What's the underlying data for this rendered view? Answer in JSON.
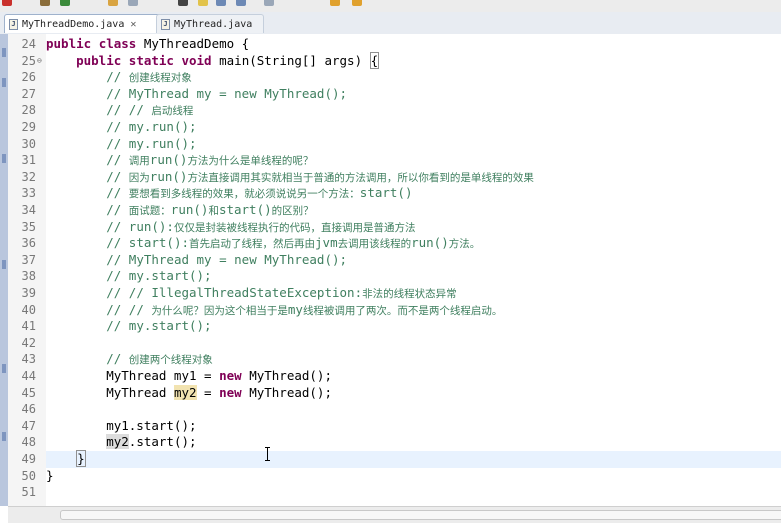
{
  "tabs": [
    {
      "label": "MyThreadDemo.java",
      "icon": "java-file-icon",
      "active": true
    },
    {
      "label": "MyThread.java",
      "icon": "java-file-icon",
      "active": false
    }
  ],
  "colors": {
    "keyword": "#7f0055",
    "comment": "#3f7f5f",
    "text": "#000000",
    "line_number": "#787878",
    "current_line": "#e8f2fe"
  },
  "lines": [
    {
      "n": "24",
      "fold": "",
      "segs": [
        [
          "public ",
          "kw"
        ],
        [
          "class ",
          "kw"
        ],
        [
          "MyThreadDemo {",
          ""
        ]
      ]
    },
    {
      "n": "25",
      "fold": "⊖",
      "segs": [
        [
          "    ",
          ""
        ],
        [
          "public ",
          "kw"
        ],
        [
          "static ",
          "kw"
        ],
        [
          "void ",
          "kw"
        ],
        [
          "main(String[] args) ",
          ""
        ],
        [
          "{",
          "brk"
        ]
      ]
    },
    {
      "n": "26",
      "fold": "",
      "segs": [
        [
          "        ",
          ""
        ],
        [
          "// ",
          "cm"
        ],
        [
          "创建线程对象",
          "cm cjk"
        ]
      ]
    },
    {
      "n": "27",
      "fold": "",
      "segs": [
        [
          "        ",
          ""
        ],
        [
          "// MyThread my = new MyThread();",
          "cm"
        ]
      ]
    },
    {
      "n": "28",
      "fold": "",
      "segs": [
        [
          "        ",
          ""
        ],
        [
          "// // ",
          "cm"
        ],
        [
          "启动线程",
          "cm cjk"
        ]
      ]
    },
    {
      "n": "29",
      "fold": "",
      "segs": [
        [
          "        ",
          ""
        ],
        [
          "// my.run();",
          "cm"
        ]
      ]
    },
    {
      "n": "30",
      "fold": "",
      "segs": [
        [
          "        ",
          ""
        ],
        [
          "// my.run();",
          "cm"
        ]
      ]
    },
    {
      "n": "31",
      "fold": "",
      "segs": [
        [
          "        ",
          ""
        ],
        [
          "// ",
          "cm"
        ],
        [
          "调用",
          "cm cjk"
        ],
        [
          "run()",
          "cm"
        ],
        [
          "方法为什么是单线程的呢？",
          "cm cjk"
        ]
      ]
    },
    {
      "n": "32",
      "fold": "",
      "segs": [
        [
          "        ",
          ""
        ],
        [
          "// ",
          "cm"
        ],
        [
          "因为",
          "cm cjk"
        ],
        [
          "run()",
          "cm"
        ],
        [
          "方法直接调用其实就相当于普通的方法调用，所以你看到的是单线程的效果",
          "cm cjk"
        ]
      ]
    },
    {
      "n": "33",
      "fold": "",
      "segs": [
        [
          "        ",
          ""
        ],
        [
          "// ",
          "cm"
        ],
        [
          "要想看到多线程的效果，就必须说说另一个方法：",
          "cm cjk"
        ],
        [
          "start()",
          "cm"
        ]
      ]
    },
    {
      "n": "34",
      "fold": "",
      "segs": [
        [
          "        ",
          ""
        ],
        [
          "// ",
          "cm"
        ],
        [
          "面试题：",
          "cm cjk"
        ],
        [
          "run()",
          "cm"
        ],
        [
          "和",
          "cm cjk"
        ],
        [
          "start()",
          "cm"
        ],
        [
          "的区别？",
          "cm cjk"
        ]
      ]
    },
    {
      "n": "35",
      "fold": "",
      "segs": [
        [
          "        ",
          ""
        ],
        [
          "// run():",
          "cm"
        ],
        [
          "仅仅是封装被线程执行的代码，直接调用是普通方法",
          "cm cjk"
        ]
      ]
    },
    {
      "n": "36",
      "fold": "",
      "segs": [
        [
          "        ",
          ""
        ],
        [
          "// start():",
          "cm"
        ],
        [
          "首先启动了线程，然后再由",
          "cm cjk"
        ],
        [
          "jvm",
          "cm"
        ],
        [
          "去调用该线程的",
          "cm cjk"
        ],
        [
          "run()",
          "cm"
        ],
        [
          "方法。",
          "cm cjk"
        ]
      ]
    },
    {
      "n": "37",
      "fold": "",
      "segs": [
        [
          "        ",
          ""
        ],
        [
          "// MyThread my = new MyThread();",
          "cm"
        ]
      ]
    },
    {
      "n": "38",
      "fold": "",
      "segs": [
        [
          "        ",
          ""
        ],
        [
          "// my.start();",
          "cm"
        ]
      ]
    },
    {
      "n": "39",
      "fold": "",
      "segs": [
        [
          "        ",
          ""
        ],
        [
          "// // IllegalThreadStateException:",
          "cm"
        ],
        [
          "非法的线程状态异常",
          "cm cjk"
        ]
      ]
    },
    {
      "n": "40",
      "fold": "",
      "segs": [
        [
          "        ",
          ""
        ],
        [
          "// // ",
          "cm"
        ],
        [
          "为什么呢？因为这个相当于是",
          "cm cjk"
        ],
        [
          "my",
          "cm"
        ],
        [
          "线程被调用了两次。而不是两个线程启动。",
          "cm cjk"
        ]
      ]
    },
    {
      "n": "41",
      "fold": "",
      "segs": [
        [
          "        ",
          ""
        ],
        [
          "// my.start();",
          "cm"
        ]
      ]
    },
    {
      "n": "42",
      "fold": "",
      "segs": []
    },
    {
      "n": "43",
      "fold": "",
      "segs": [
        [
          "        ",
          ""
        ],
        [
          "// ",
          "cm"
        ],
        [
          "创建两个线程对象",
          "cm cjk"
        ]
      ]
    },
    {
      "n": "44",
      "fold": "",
      "segs": [
        [
          "        MyThread my1 = ",
          ""
        ],
        [
          "new ",
          "kw"
        ],
        [
          "MyThread();",
          ""
        ]
      ]
    },
    {
      "n": "45",
      "fold": "",
      "segs": [
        [
          "        MyThread ",
          ""
        ],
        [
          "my2",
          "hl"
        ],
        [
          " = ",
          ""
        ],
        [
          "new ",
          "kw"
        ],
        [
          "MyThread();",
          ""
        ]
      ]
    },
    {
      "n": "46",
      "fold": "",
      "segs": []
    },
    {
      "n": "47",
      "fold": "",
      "segs": [
        [
          "        my1.start();",
          ""
        ]
      ]
    },
    {
      "n": "48",
      "fold": "",
      "segs": [
        [
          "        ",
          ""
        ],
        [
          "my2",
          "gray"
        ],
        [
          ".start();",
          ""
        ]
      ]
    },
    {
      "n": "49",
      "fold": "",
      "segs": [
        [
          "    ",
          ""
        ],
        [
          "}",
          "brk"
        ]
      ]
    },
    {
      "n": "50",
      "fold": "",
      "segs": [
        [
          "}",
          ""
        ]
      ]
    },
    {
      "n": "51",
      "fold": "",
      "segs": []
    }
  ],
  "current_line_index": 25
}
